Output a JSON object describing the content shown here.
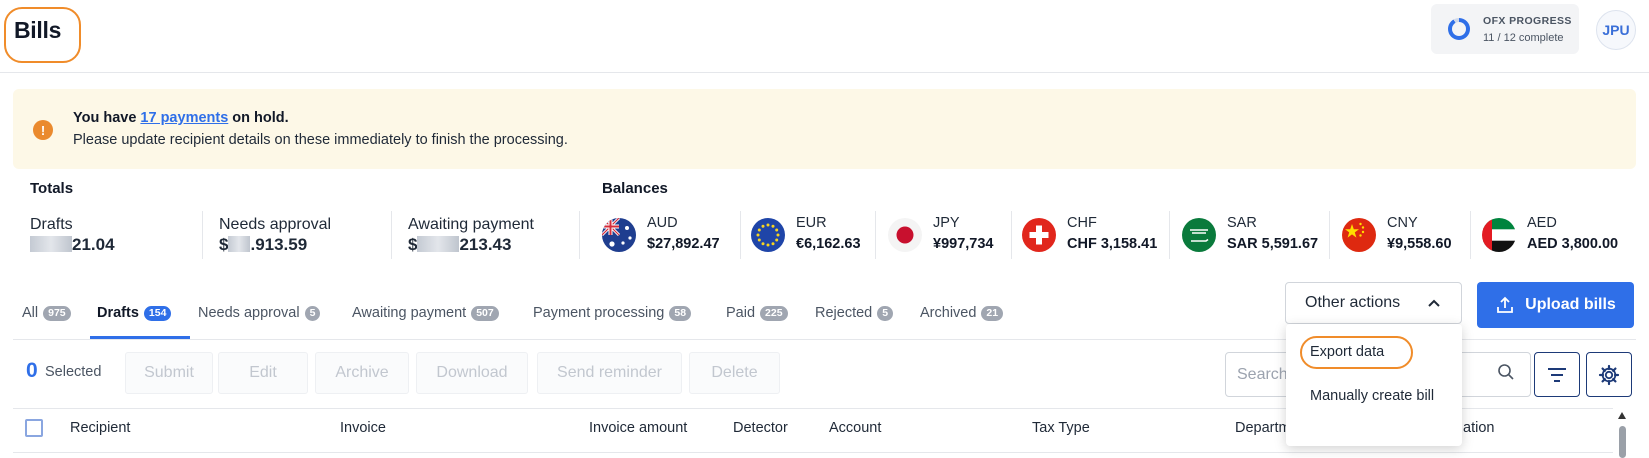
{
  "header": {
    "title": "Bills",
    "ofx": {
      "label": "OFX PROGRESS",
      "status": "11 / 12 complete",
      "progress": 0.9167
    },
    "avatar_initials": "JPU"
  },
  "banner": {
    "prefix": "You have ",
    "link": "17 payments",
    "suffix": " on hold.",
    "message": "Please update recipient details on these immediately to finish the processing."
  },
  "totals": {
    "heading": "Totals",
    "items": [
      {
        "label": "Drafts",
        "value_prefix": "",
        "value_suffix": "21.04"
      },
      {
        "label": "Needs approval",
        "value_prefix": "$",
        "value_suffix": ".913.59"
      },
      {
        "label": "Awaiting payment",
        "value_prefix": "$",
        "value_suffix": "213.43"
      }
    ]
  },
  "balances": {
    "heading": "Balances",
    "items": [
      {
        "code": "AUD",
        "amount": "$27,892.47",
        "flag": "au-flag-icon"
      },
      {
        "code": "EUR",
        "amount": "€6,162.63",
        "flag": "eu-flag-icon"
      },
      {
        "code": "JPY",
        "amount": "¥997,734",
        "flag": "jp-flag-icon"
      },
      {
        "code": "CHF",
        "amount": "CHF 3,158.41",
        "flag": "ch-flag-icon"
      },
      {
        "code": "SAR",
        "amount": "SAR 5,591.67",
        "flag": "sa-flag-icon"
      },
      {
        "code": "CNY",
        "amount": "¥9,558.60",
        "flag": "cn-flag-icon"
      },
      {
        "code": "AED",
        "amount": "AED 3,800.00",
        "flag": "ae-flag-icon"
      }
    ]
  },
  "tabs": [
    {
      "label": "All",
      "count": "975"
    },
    {
      "label": "Drafts",
      "count": "154",
      "active": true
    },
    {
      "label": "Needs approval",
      "count": "5"
    },
    {
      "label": "Awaiting payment",
      "count": "507"
    },
    {
      "label": "Payment processing",
      "count": "58"
    },
    {
      "label": "Paid",
      "count": "225"
    },
    {
      "label": "Rejected",
      "count": "5"
    },
    {
      "label": "Archived",
      "count": "21"
    }
  ],
  "actions": {
    "other_actions": "Other actions",
    "upload": "Upload bills",
    "selected_count": "0",
    "selected_label": "Selected",
    "buttons": [
      "Submit",
      "Edit",
      "Archive",
      "Download",
      "Send reminder",
      "Delete"
    ],
    "search_placeholder": "Search"
  },
  "menu": {
    "items": [
      "Export data",
      "Manually create bill"
    ]
  },
  "table": {
    "columns": [
      "Recipient",
      "Invoice",
      "Invoice amount",
      "Detector",
      "Account",
      "Tax Type",
      "Departm",
      "ation"
    ]
  },
  "colors": {
    "accent": "#2f6fe8",
    "highlight": "#f08c2a",
    "banner_bg": "#fdf8e7",
    "warning": "#ea8a2e"
  }
}
